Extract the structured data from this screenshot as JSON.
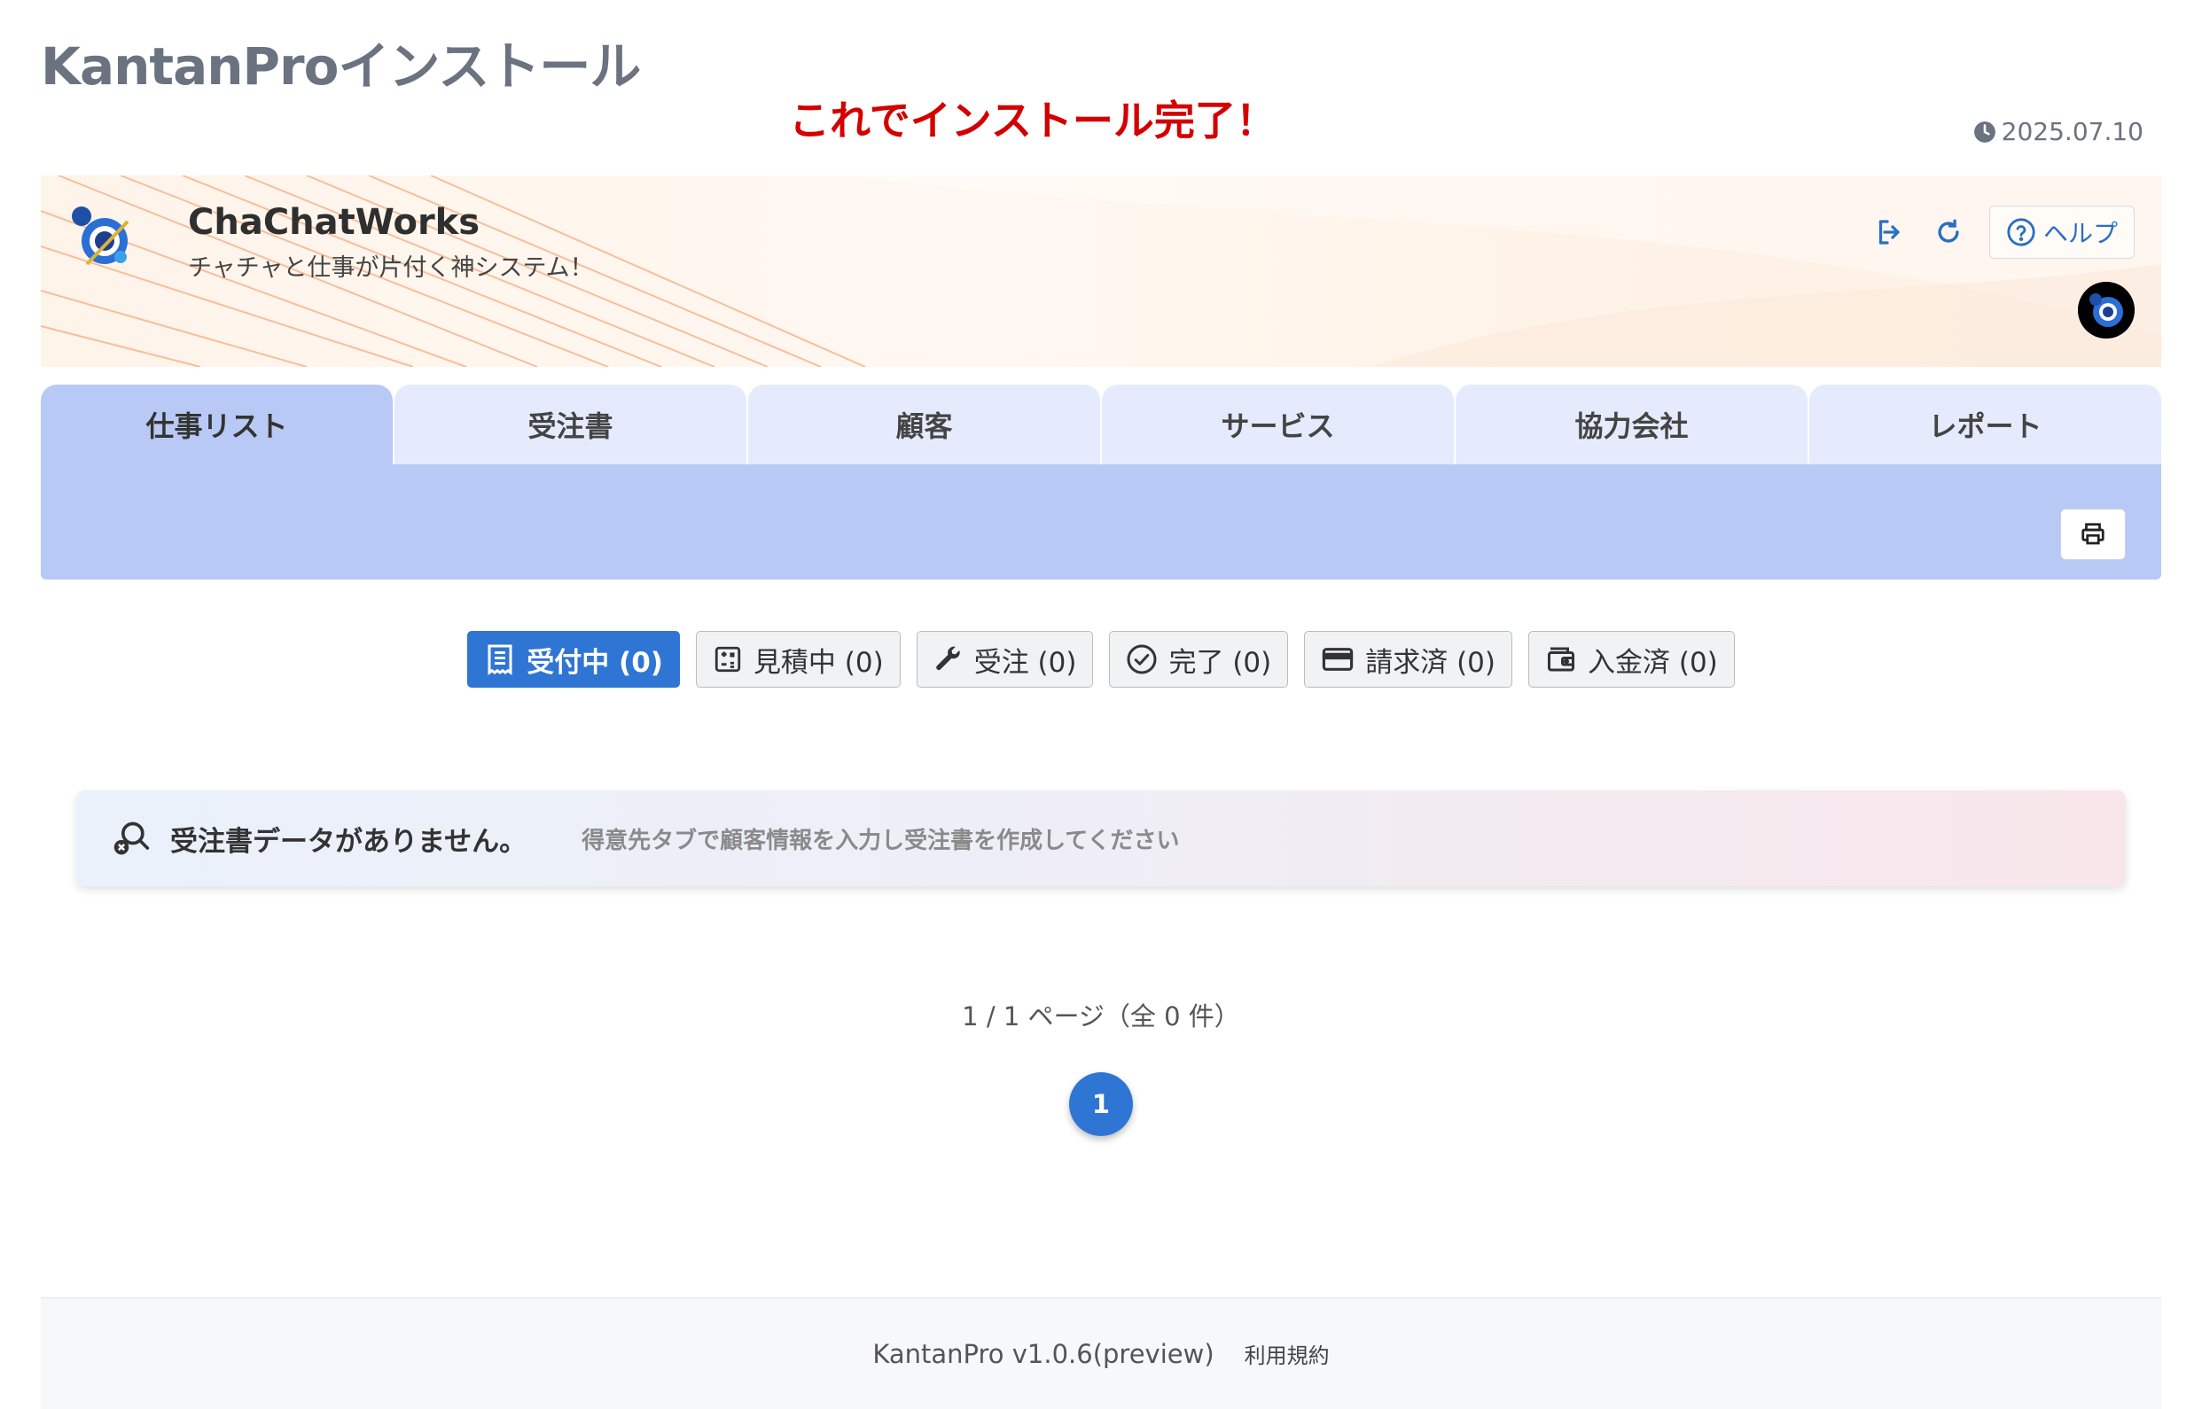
{
  "page": {
    "title": "KantanProインストール",
    "annotation": "これでインストール完了！",
    "date": "2025.07.10"
  },
  "header": {
    "app_name": "ChaChatWorks",
    "tagline": "チャチャと仕事が片付く神システム！",
    "help_label": "ヘルプ",
    "icons": [
      "logout-icon",
      "reload-icon",
      "help-circle-icon"
    ]
  },
  "tabs": [
    {
      "label": "仕事リスト",
      "active": true
    },
    {
      "label": "受注書",
      "active": false
    },
    {
      "label": "顧客",
      "active": false
    },
    {
      "label": "サービス",
      "active": false
    },
    {
      "label": "協力会社",
      "active": false
    },
    {
      "label": "レポート",
      "active": false
    }
  ],
  "filters": [
    {
      "label": "受付中 (0)",
      "icon": "receipt-icon",
      "active": true
    },
    {
      "label": "見積中 (0)",
      "icon": "calculator-icon",
      "active": false
    },
    {
      "label": "受注 (0)",
      "icon": "wrench-icon",
      "active": false
    },
    {
      "label": "完了 (0)",
      "icon": "check-circle-icon",
      "active": false
    },
    {
      "label": "請求済 (0)",
      "icon": "credit-card-icon",
      "active": false
    },
    {
      "label": "入金済 (0)",
      "icon": "wallet-icon",
      "active": false
    }
  ],
  "empty_state": {
    "title": "受注書データがありません。",
    "hint": "得意先タブで顧客情報を入力し受注書を作成してください"
  },
  "pagination": {
    "info": "1 / 1 ページ（全 0 件）",
    "current_page": "1"
  },
  "footer": {
    "version": "KantanPro v1.0.6(preview)",
    "terms": "利用規約"
  },
  "colors": {
    "accent": "#2f75d4",
    "tab_active": "#b8c9f5",
    "tab_inactive": "#e5ebfc",
    "annotation": "#d40000"
  }
}
